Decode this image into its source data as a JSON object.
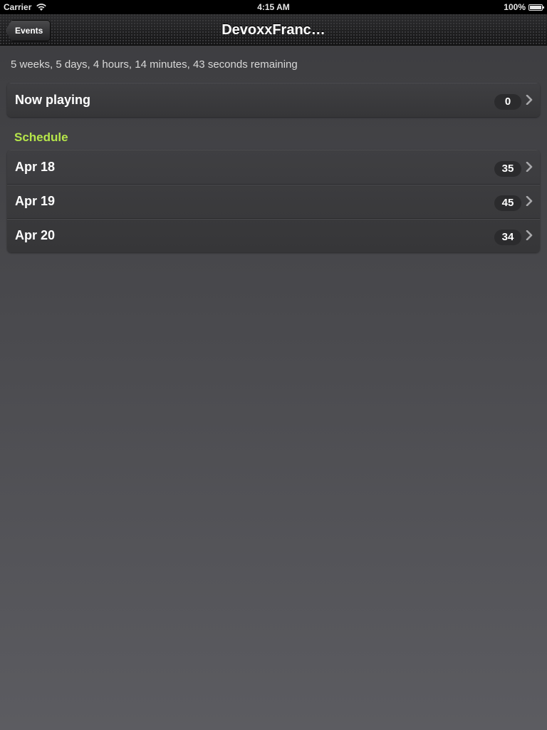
{
  "status_bar": {
    "carrier": "Carrier",
    "time": "4:15 AM",
    "battery": "100%"
  },
  "nav": {
    "back_label": "Events",
    "title": "DevoxxFranc…"
  },
  "countdown": "5 weeks, 5 days, 4 hours, 14 minutes, 43 seconds remaining",
  "now_playing": {
    "label": "Now playing",
    "count": "0"
  },
  "schedule": {
    "header": "Schedule",
    "days": [
      {
        "label": "Apr 18",
        "count": "35"
      },
      {
        "label": "Apr 19",
        "count": "45"
      },
      {
        "label": "Apr 20",
        "count": "34"
      }
    ]
  },
  "colors": {
    "section_header": "#b6e64a",
    "background_top": "#3c3c3f",
    "background_bottom": "#5c5c61"
  },
  "icons": {
    "wifi": "wifi-icon",
    "battery": "battery-icon",
    "chevron": "chevron-right-icon"
  }
}
